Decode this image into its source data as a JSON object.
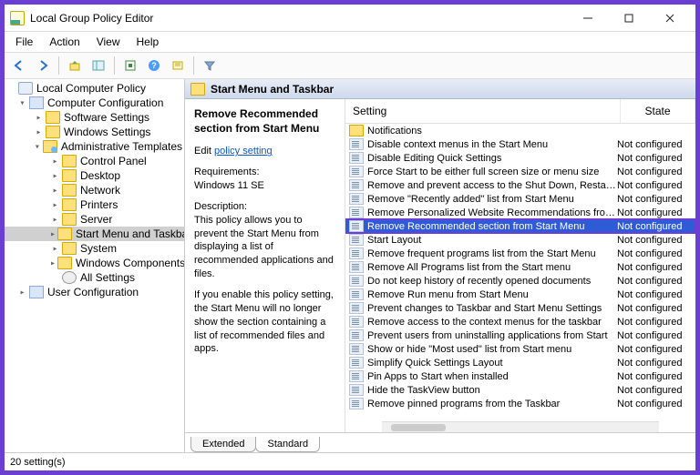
{
  "window": {
    "title": "Local Group Policy Editor"
  },
  "menubar": [
    "File",
    "Action",
    "View",
    "Help"
  ],
  "tree": {
    "root": "Local Computer Policy",
    "computer": "Computer Configuration",
    "software": "Software Settings",
    "windows": "Windows Settings",
    "admin": "Administrative Templates",
    "admin_children": [
      "Control Panel",
      "Desktop",
      "Network",
      "Printers",
      "Server",
      "Start Menu and Taskbar",
      "System",
      "Windows Components",
      "All Settings"
    ],
    "user": "User Configuration"
  },
  "path": "Start Menu and Taskbar",
  "detail": {
    "title": "Remove Recommended section from Start Menu",
    "edit_prefix": "Edit",
    "edit_link": "policy setting",
    "req_label": "Requirements:",
    "req_value": "Windows 11 SE",
    "desc_label": "Description:",
    "desc1": "This policy allows you to prevent the Start Menu from displaying a list of recommended applications and files.",
    "desc2": "If you enable this policy setting, the Start Menu will no longer show the section containing a list of recommended files and apps."
  },
  "columns": {
    "setting": "Setting",
    "state": "State"
  },
  "folder_row": "Notifications",
  "settings": [
    {
      "name": "Disable context menus in the Start Menu",
      "state": "Not configured"
    },
    {
      "name": "Disable Editing Quick Settings",
      "state": "Not configured"
    },
    {
      "name": "Force Start to be either full screen size or menu size",
      "state": "Not configured"
    },
    {
      "name": "Remove and prevent access to the Shut Down, Restart, Sleep...",
      "state": "Not configured"
    },
    {
      "name": "Remove \"Recently added\" list from Start Menu",
      "state": "Not configured"
    },
    {
      "name": "Remove Personalized Website Recommendations from the ...",
      "state": "Not configured"
    },
    {
      "name": "Remove Recommended section from Start Menu",
      "state": "Not configured",
      "highlight": true
    },
    {
      "name": "Start Layout",
      "state": "Not configured"
    },
    {
      "name": "Remove frequent programs list from the Start Menu",
      "state": "Not configured"
    },
    {
      "name": "Remove All Programs list from the Start menu",
      "state": "Not configured"
    },
    {
      "name": "Do not keep history of recently opened documents",
      "state": "Not configured"
    },
    {
      "name": "Remove Run menu from Start Menu",
      "state": "Not configured"
    },
    {
      "name": "Prevent changes to Taskbar and Start Menu Settings",
      "state": "Not configured"
    },
    {
      "name": "Remove access to the context menus for the taskbar",
      "state": "Not configured"
    },
    {
      "name": "Prevent users from uninstalling applications from Start",
      "state": "Not configured"
    },
    {
      "name": "Show or hide \"Most used\" list from Start menu",
      "state": "Not configured"
    },
    {
      "name": "Simplify Quick Settings Layout",
      "state": "Not configured"
    },
    {
      "name": "Pin Apps to Start when installed",
      "state": "Not configured"
    },
    {
      "name": "Hide the TaskView button",
      "state": "Not configured"
    },
    {
      "name": "Remove pinned programs from the Taskbar",
      "state": "Not configured"
    }
  ],
  "tabs": {
    "extended": "Extended",
    "standard": "Standard"
  },
  "status": "20 setting(s)"
}
